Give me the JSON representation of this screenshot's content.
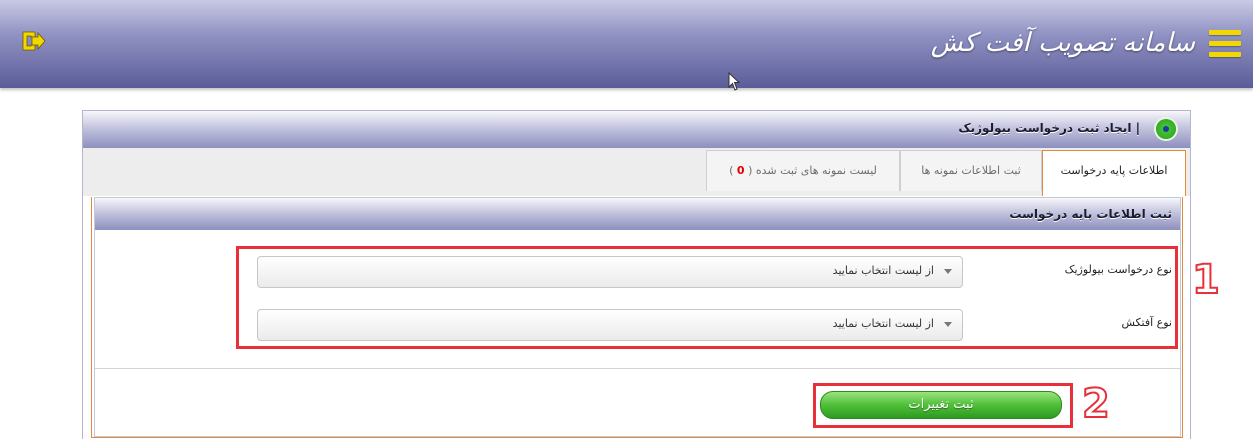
{
  "header": {
    "app_title": "سامانه تصویب آفت کش",
    "menu_icon": "hamburger-menu-icon",
    "exit_icon": "exit-icon",
    "accent_color": "#f3d800"
  },
  "panel": {
    "title": "| ایجاد ثبت درخواست بیولوژیک",
    "tabs": [
      {
        "label": "اطلاعات پایه درخواست",
        "active": true
      },
      {
        "label": "ثبت اطلاعات نمونه ها",
        "active": false
      },
      {
        "label_prefix": "لیست نمونه های ثبت شده (",
        "count": "0",
        "label_suffix": ")",
        "active": false
      }
    ]
  },
  "form": {
    "section_title": "ثبت اطلاعات پایه درخواست",
    "fields": [
      {
        "label": "نوع درخواست بیولوژیک",
        "value": "از لیست انتخاب نمایید"
      },
      {
        "label": "نوع آفتکش",
        "value": "از لیست انتخاب نمایید"
      }
    ],
    "save_label": "ثبت تغییرات"
  },
  "annotations": {
    "box1_number": "1",
    "box2_number": "2",
    "color": "#e8303a"
  }
}
